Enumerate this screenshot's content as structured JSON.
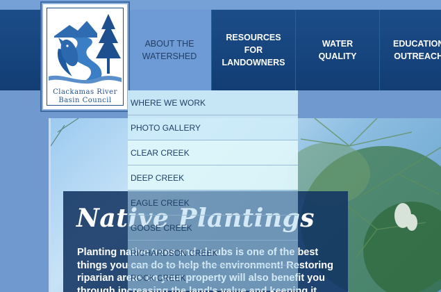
{
  "logo": {
    "line1": "Clackamas River",
    "line2": "Basin Council"
  },
  "nav": {
    "items": [
      {
        "label": "ABOUT THE\nWATERSHED"
      },
      {
        "label": "RESOURCES FOR\nLANDOWNERS"
      },
      {
        "label": "WATER QUALITY"
      },
      {
        "label": "EDUCATION\nOUTREACH"
      }
    ]
  },
  "dropdown": {
    "items": [
      {
        "label": "WHERE WE WORK"
      },
      {
        "label": "PHOTO GALLERY"
      },
      {
        "label": "CLEAR CREEK"
      },
      {
        "label": "DEEP CREEK"
      },
      {
        "label": "EAGLE CREEK"
      },
      {
        "label": "GOOSE CREEK"
      },
      {
        "label": "RICHARDSON CREEK"
      },
      {
        "label": "ROCK CREEK"
      }
    ]
  },
  "hero": {
    "title": "Native Plantings",
    "body": "Planting native trees and shrubs is one of the best things you can do to help the environment! Restoring riparian areas on your property will also benefit you through increasing the land's value and keeping it"
  },
  "colors": {
    "nav_bg": "#1c4d88",
    "nav_active": "#6e9ad6",
    "brand_blue": "#1e4f8e"
  }
}
